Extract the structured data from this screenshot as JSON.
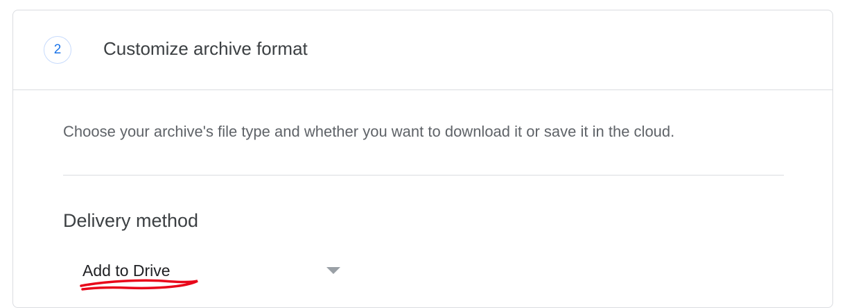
{
  "step": {
    "number": "2",
    "title": "Customize archive format"
  },
  "description": "Choose your archive's file type and whether you want to download it or save it in the cloud.",
  "delivery": {
    "heading": "Delivery method",
    "selected_value": "Add to Drive"
  },
  "colors": {
    "accent": "#1a73e8",
    "annotation": "#e8071a"
  }
}
